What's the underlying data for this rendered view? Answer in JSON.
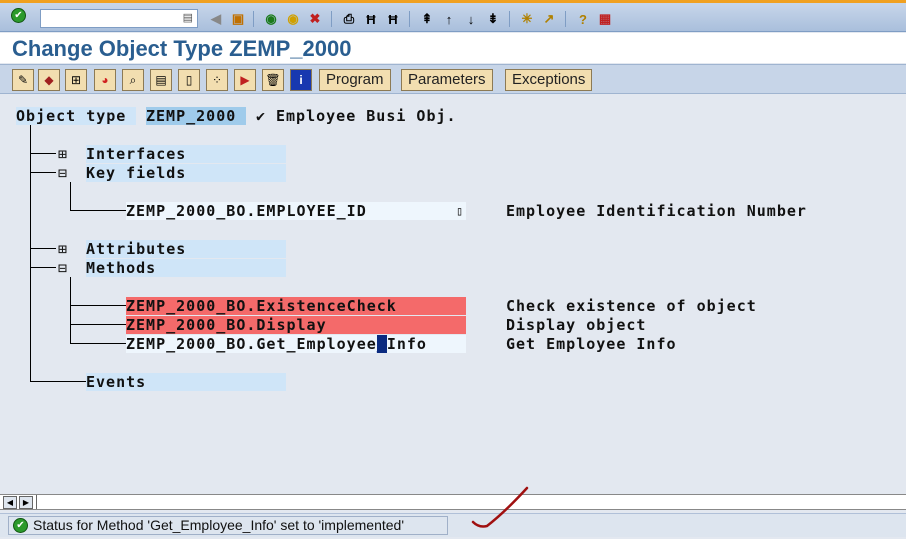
{
  "toolbar": {
    "command_placeholder": ""
  },
  "title": "Change Object Type ZEMP_2000",
  "app_toolbar": {
    "buttons": [
      "Program",
      "Parameters",
      "Exceptions"
    ]
  },
  "header": {
    "label": "Object type",
    "value": "ZEMP_2000",
    "check": "✔",
    "description": "Employee Busi Obj."
  },
  "tree": {
    "interfaces": "Interfaces",
    "key_fields": "Key fields",
    "key_field_item": {
      "name": "ZEMP_2000_BO.EMPLOYEE_ID",
      "description": "Employee Identification Number"
    },
    "attributes": "Attributes",
    "methods": "Methods",
    "method_items": [
      {
        "name": "ZEMP_2000_BO.ExistenceCheck",
        "description": "Check existence of object",
        "status": "error"
      },
      {
        "name": "ZEMP_2000_BO.Display",
        "description": "Display object",
        "status": "error"
      },
      {
        "name_pre": "ZEMP_2000_BO.Get_Employee",
        "name_cursor": "_",
        "name_post": "Info",
        "description": "Get Employee Info",
        "status": "implemented"
      }
    ],
    "events": "Events"
  },
  "status": {
    "message": "Status for Method 'Get_Employee_Info' set to 'implemented'"
  },
  "colors": {
    "title": "#2a5e90",
    "error_row": "#f46a6a",
    "label_bg": "#cfe5f8"
  }
}
